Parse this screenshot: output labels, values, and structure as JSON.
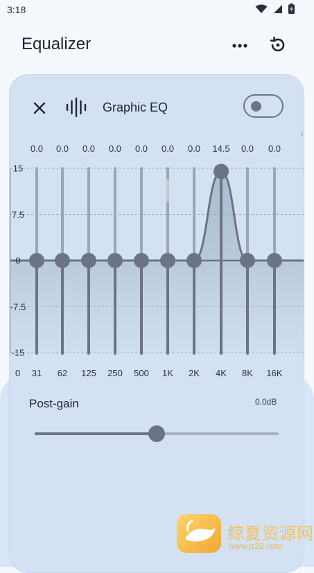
{
  "status": {
    "time": "3:18"
  },
  "appbar": {
    "title": "Equalizer"
  },
  "eq": {
    "title": "Graphic EQ",
    "enabled": false,
    "y_ticks": [
      "15",
      "7.5",
      "0",
      "-7.5",
      "-15"
    ],
    "axis_zero": "0",
    "bands": [
      {
        "freq": "31",
        "gain": 0.0,
        "label": "0.0"
      },
      {
        "freq": "62",
        "gain": 0.0,
        "label": "0.0"
      },
      {
        "freq": "125",
        "gain": 0.0,
        "label": "0.0"
      },
      {
        "freq": "250",
        "gain": 0.0,
        "label": "0.0"
      },
      {
        "freq": "500",
        "gain": 0.0,
        "label": "0.0"
      },
      {
        "freq": "1K",
        "gain": 0.0,
        "label": "0.0"
      },
      {
        "freq": "2K",
        "gain": 0.0,
        "label": "0.0"
      },
      {
        "freq": "4K",
        "gain": 14.5,
        "label": "14.5"
      },
      {
        "freq": "8K",
        "gain": 0.0,
        "label": "0.0"
      },
      {
        "freq": "16K",
        "gain": 0.0,
        "label": "0.0"
      }
    ]
  },
  "postgain": {
    "label": "Post-gain",
    "value_text": "0.0dB",
    "fraction": 0.5
  },
  "watermark": {
    "text": "鲸夏资源网",
    "url": "www.jz22.com"
  },
  "colors": {
    "accent": "#6a7486",
    "card": "#d3e1f3",
    "fill": "#b4c2d8"
  }
}
